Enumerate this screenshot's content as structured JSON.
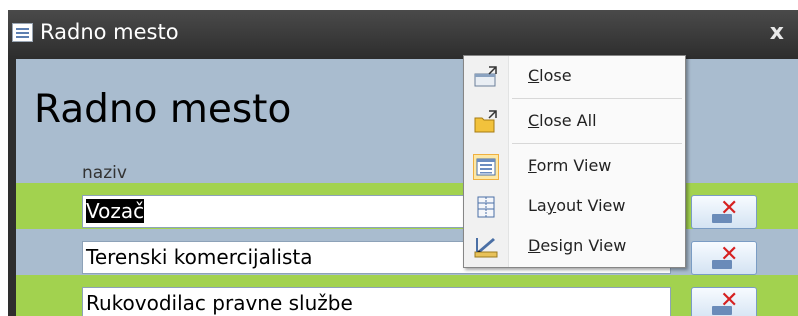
{
  "window": {
    "title": "Radno mesto",
    "close_label": "x"
  },
  "form": {
    "heading": "Radno mesto",
    "column_label": "naziv",
    "rows": [
      {
        "value": "Vozač",
        "selected": true
      },
      {
        "value": "Terenski komercijalista",
        "selected": false
      },
      {
        "value": "Rukovodilac pravne službe",
        "selected": false
      }
    ]
  },
  "context_menu": {
    "items": [
      {
        "accel": "C",
        "rest": "lose",
        "icon": "close-window-icon"
      },
      {
        "accel": "C",
        "rest": "lose All",
        "icon": "close-all-folder-icon"
      },
      {
        "accel": "F",
        "rest": "orm View",
        "icon": "form-view-icon",
        "active": true
      },
      {
        "pre": "La",
        "accel": "y",
        "rest": "out View",
        "icon": "layout-view-icon"
      },
      {
        "accel": "D",
        "rest": "esign View",
        "icon": "design-view-icon"
      }
    ]
  }
}
